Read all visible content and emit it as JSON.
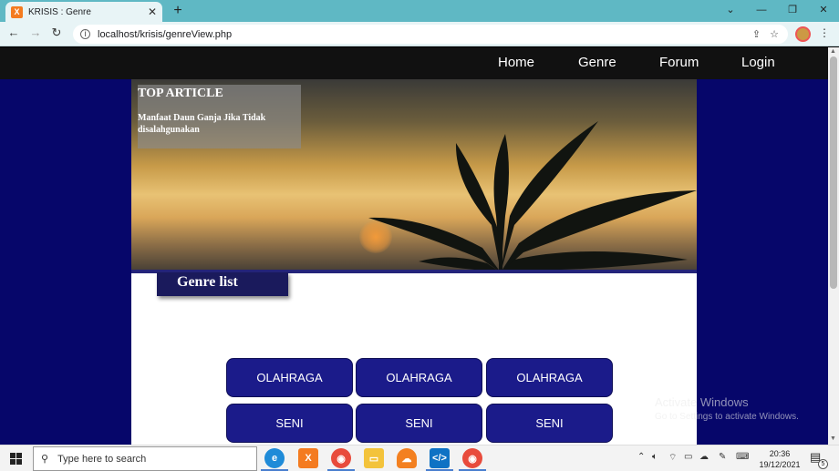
{
  "browser": {
    "tab_title": "KRISIS : Genre",
    "tab_favicon_letter": "X",
    "new_tab": "+",
    "url": "localhost/krisis/genreView.php",
    "window_controls": [
      "⌄",
      "—",
      "❐",
      "✕"
    ]
  },
  "navbar": {
    "links": [
      "Home",
      "Genre",
      "Forum",
      "Login"
    ]
  },
  "hero": {
    "panel_title": "TOP ARTICLE",
    "article_title": "Manfaat Daun Ganja Jika Tidak disalahgunakan"
  },
  "genre_section": {
    "heading": "Genre list",
    "rows": [
      [
        "OLAHRAGA",
        "OLAHRAGA",
        "OLAHRAGA"
      ],
      [
        "SENI",
        "SENI",
        "SENI"
      ]
    ]
  },
  "watermark": {
    "line1": "Activate Windows",
    "line2": "Go to Settings to activate Windows."
  },
  "taskbar": {
    "search_placeholder": "Type here to search",
    "time": "20:36",
    "date": "19/12/2021",
    "notification_count": "5",
    "apps": [
      "edge-icon",
      "xampp-icon",
      "chrome-icon",
      "file-explorer-icon",
      "cloud-icon",
      "vscode-icon",
      "chrome-icon"
    ]
  },
  "colors": {
    "page_background": "#06066a",
    "navbar": "#111111",
    "genre_button": "#1b1b8a",
    "tabstrip": "#5fb8c4"
  }
}
